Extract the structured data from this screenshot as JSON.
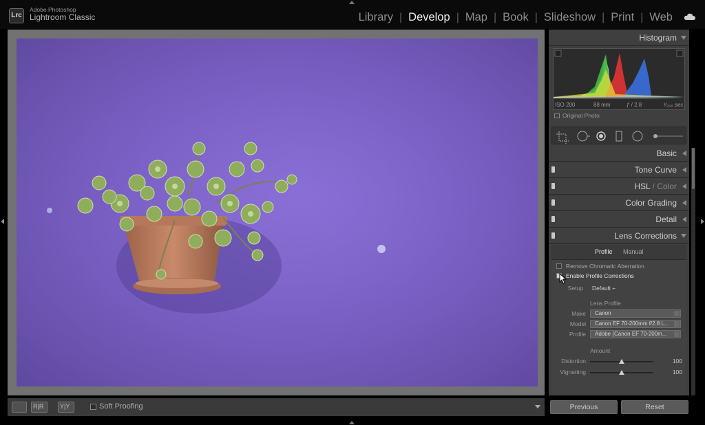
{
  "app": {
    "logo": "Lrc",
    "vendor": "Adobe Photoshop",
    "name": "Lightroom Classic"
  },
  "modules": [
    "Library",
    "Develop",
    "Map",
    "Book",
    "Slideshow",
    "Print",
    "Web"
  ],
  "active_module": "Develop",
  "toolbar": {
    "soft_proofing": "Soft Proofing",
    "loupe_icon": "loupe-view-icon",
    "compare_icon": "before-after-icon"
  },
  "histogram": {
    "title": "Histogram",
    "iso": "ISO 200",
    "focal": "88 mm",
    "aperture": "ƒ / 2.8",
    "shutter": "¹⁄₂₀₀ sec",
    "original_photo": "Original Photo"
  },
  "sections": {
    "basic": "Basic",
    "tone_curve": "Tone Curve",
    "hsl": "HSL",
    "hsl_sep": " / ",
    "color": "Color",
    "color_grading": "Color Grading",
    "detail": "Detail",
    "lens_corrections": "Lens Corrections"
  },
  "lens": {
    "tab_profile": "Profile",
    "tab_manual": "Manual",
    "remove_ca": "Remove Chromatic Aberration",
    "enable_profile": "Enable Profile Corrections",
    "setup_label": "Setup",
    "setup_value": "Default ÷",
    "lens_profile_title": "Lens Profile",
    "make_label": "Make",
    "make_value": "Canon",
    "model_label": "Model",
    "model_value": "Canon EF 70-200mm f/2.8 L...",
    "profile_label": "Profile",
    "profile_value": "Adobe (Canon EF 70-200m...",
    "amount_title": "Amount",
    "distortion_label": "Distortion",
    "distortion_value": "100",
    "vignetting_label": "Vignetting",
    "vignetting_value": "100"
  },
  "buttons": {
    "previous": "Previous",
    "reset": "Reset"
  },
  "colors": {
    "wall": "#7d62c8",
    "pot": "#b87c5e",
    "panel": "#3f3f3f",
    "accent_text": "#f0f0f0"
  }
}
